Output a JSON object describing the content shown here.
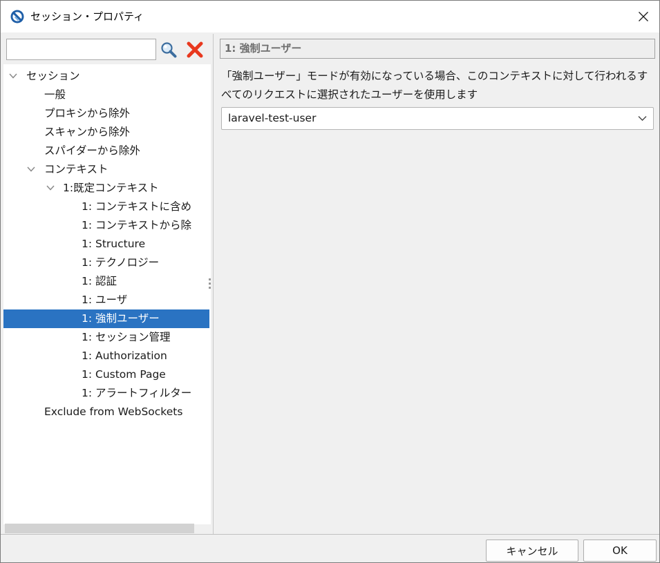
{
  "window": {
    "title": "セッション・プロパティ"
  },
  "search": {
    "value": "",
    "placeholder": ""
  },
  "tree": {
    "items": [
      {
        "label": "セッション",
        "level": 0,
        "expanded": true
      },
      {
        "label": "一般",
        "level": 1
      },
      {
        "label": "プロキシから除外",
        "level": 1
      },
      {
        "label": "スキャンから除外",
        "level": 1
      },
      {
        "label": "スパイダーから除外",
        "level": 1
      },
      {
        "label": "コンテキスト",
        "level": 1,
        "expanded": true
      },
      {
        "label": "1:既定コンテキスト",
        "level": 2,
        "expanded": true
      },
      {
        "label": "1: コンテキストに含め",
        "level": 3
      },
      {
        "label": "1: コンテキストから除",
        "level": 3
      },
      {
        "label": "1: Structure",
        "level": 3
      },
      {
        "label": "1: テクノロジー",
        "level": 3
      },
      {
        "label": "1: 認証",
        "level": 3
      },
      {
        "label": "1: ユーザ",
        "level": 3
      },
      {
        "label": "1: 強制ユーザー",
        "level": 3,
        "selected": true
      },
      {
        "label": "1: セッション管理",
        "level": 3
      },
      {
        "label": "1: Authorization",
        "level": 3
      },
      {
        "label": "1: Custom Page",
        "level": 3
      },
      {
        "label": "1: アラートフィルター",
        "level": 3
      },
      {
        "label": "Exclude from WebSockets",
        "level": 1
      }
    ]
  },
  "panel": {
    "header": "1: 強制ユーザー",
    "description": "「強制ユーザー」モードが有効になっている場合、このコンテキストに対して行われるすべてのリクエストに選択されたユーザーを使用します",
    "user_select": {
      "selected": "laravel-test-user"
    }
  },
  "buttons": {
    "cancel": "キャンセル",
    "ok": "OK"
  },
  "colors": {
    "selection": "#2a73c2",
    "clear_icon": "#e8381e",
    "app_icon": "#1f5fa8"
  },
  "icons": {
    "search": "magnifier-icon",
    "clear": "red-x-icon",
    "app": "zap-logo-icon",
    "close": "close-icon",
    "chevron": "chevron-down-icon"
  }
}
